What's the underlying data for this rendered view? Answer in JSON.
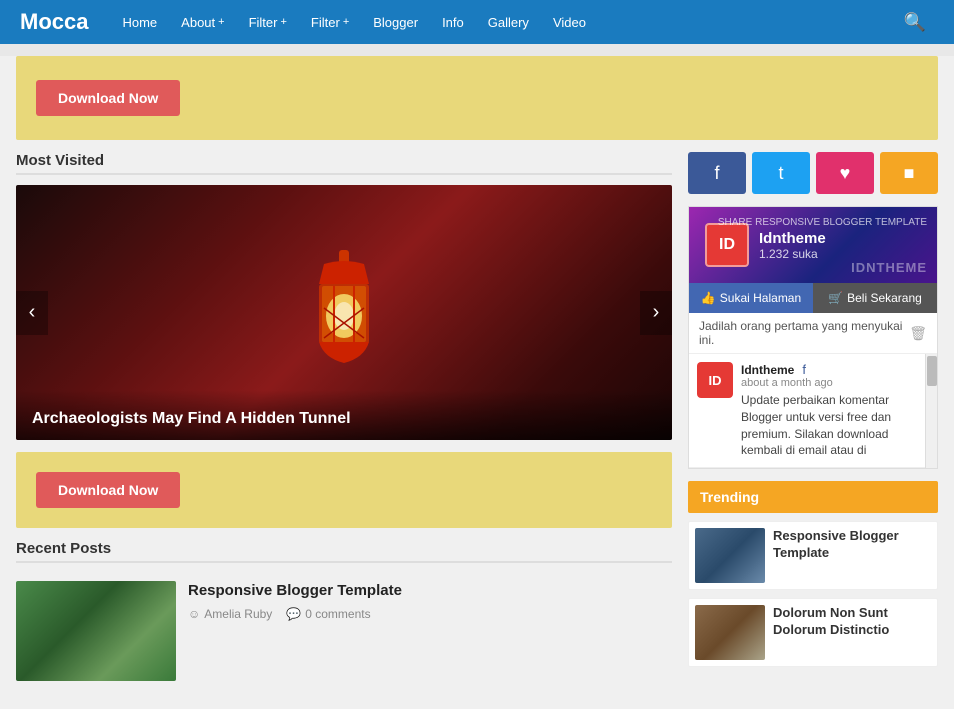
{
  "brand": "Mocca",
  "nav": {
    "links": [
      {
        "label": "Home",
        "has_plus": false
      },
      {
        "label": "About",
        "has_plus": true
      },
      {
        "label": "Filter",
        "has_plus": true
      },
      {
        "label": "Filter",
        "has_plus": true
      },
      {
        "label": "Blogger",
        "has_plus": false
      },
      {
        "label": "Info",
        "has_plus": false
      },
      {
        "label": "Gallery",
        "has_plus": false
      },
      {
        "label": "Video",
        "has_plus": false
      }
    ]
  },
  "banner_top": {
    "button_label": "Download Now"
  },
  "most_visited": {
    "section_title": "Most Visited",
    "slider_caption": "Archaeologists May Find A Hidden Tunnel"
  },
  "banner_bottom": {
    "button_label": "Download Now"
  },
  "recent_posts": {
    "section_title": "Recent Posts",
    "items": [
      {
        "title": "Responsive Blogger Template",
        "author": "Amelia Ruby",
        "comments": "0 comments"
      }
    ]
  },
  "sidebar": {
    "social": {
      "facebook": "f",
      "twitter": "t",
      "instagram": "&#9829;",
      "googleplus": "&#9679;"
    },
    "fb_widget": {
      "name": "Idntheme",
      "likes": "1.232 suka",
      "brand": "IDNTHEME",
      "subtitle": "SHARE RESPONSIVE BLOGGER TEMPLATE",
      "like_btn": "Sukai Halaman",
      "buy_btn": "Beli Sekarang",
      "first_text": "Jadilah orang pertama yang menyukai ini.",
      "post_author": "Idntheme",
      "post_time": "about a month ago",
      "post_content": "Update perbaikan komentar Blogger untuk versi free dan premium. Silakan download kembali di email atau di"
    },
    "trending": {
      "title": "Trending",
      "items": [
        {
          "title": "Responsive Blogger Template"
        },
        {
          "title": "Dolorum Non Sunt Dolorum Distinctio"
        }
      ]
    }
  }
}
